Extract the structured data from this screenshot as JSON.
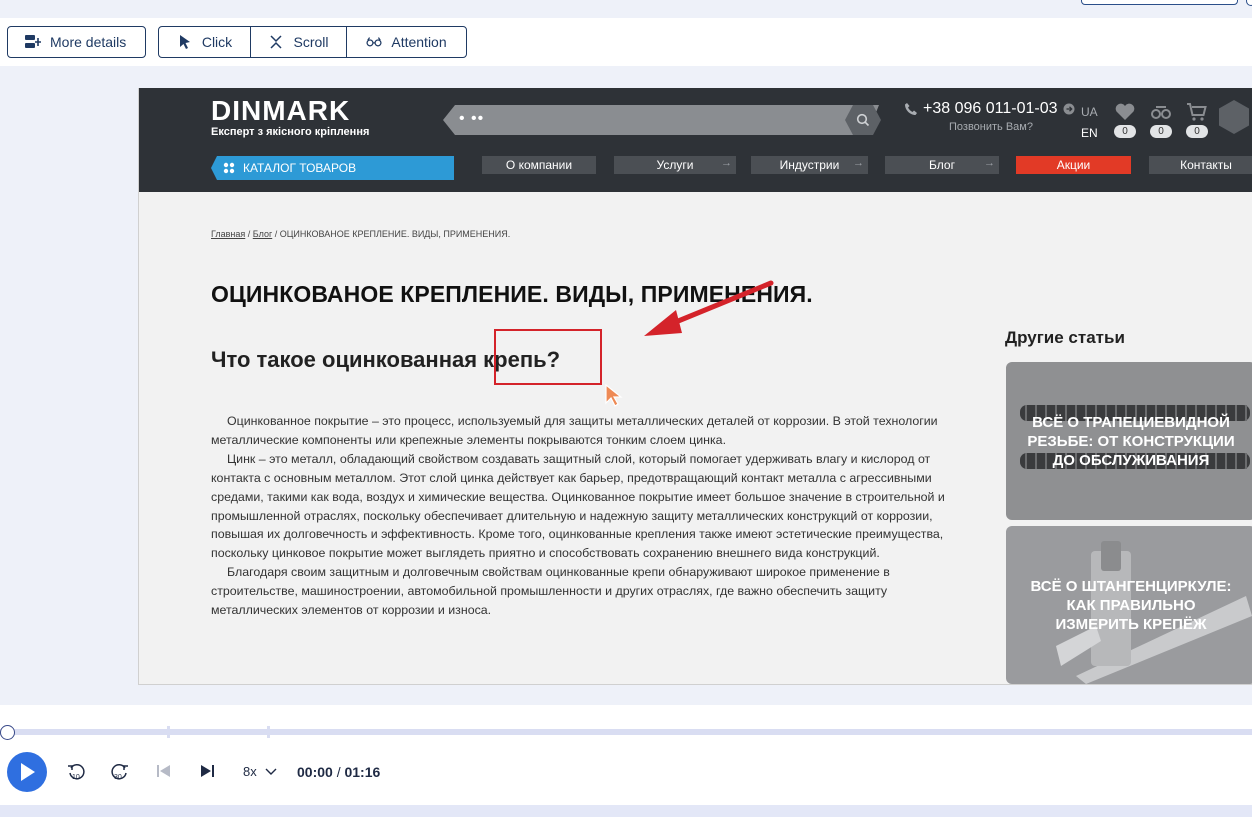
{
  "toolbar": {
    "more_details": "More details",
    "click": "Click",
    "scroll": "Scroll",
    "attention": "Attention"
  },
  "site": {
    "logo_word": "DINMARK",
    "logo_tagline": "Експерт з якісного кріплення",
    "search_value": "• ••",
    "phone": "+38 096 011-01-03",
    "callback": "Позвонить Вам?",
    "lang_ua": "UA",
    "lang_en": "EN",
    "wishlist_count": "0",
    "compare_count": "0",
    "cart_count": "0",
    "catalog": "КАТАЛОГ ТОВАРОВ",
    "nav": [
      "О компании",
      "Услуги",
      "Индустрии",
      "Блог",
      "Акции",
      "Контакты"
    ],
    "sale_color": "#e23a26",
    "accent_color": "#2d9ad6"
  },
  "breadcrumb": {
    "home": "Главная",
    "blog": "Блог",
    "current": "ОЦИНКОВАНОЕ КРЕПЛЕНИЕ. ВИДЫ, ПРИМЕНЕНИЯ."
  },
  "article": {
    "title": "ОЦИНКОВАНОЕ КРЕПЛЕНИЕ. ВИДЫ, ПРИМЕНЕНИЯ.",
    "subtitle": "Что такое оцинкованная крепь?",
    "paragraphs": [
      "Оцинкованное покрытие – это процесс, используемый для защиты металлических деталей от коррозии. В этой технологии металлические компоненты или крепежные элементы покрываются тонким слоем цинка.",
      "Цинк – это металл, обладающий свойством создавать защитный слой, который помогает удерживать влагу и кислород от контакта с основным металлом. Этот слой цинка действует как барьер, предотвращающий контакт металла с агрессивными средами, такими как вода, воздух и химические вещества. Оцинкованное покрытие имеет большое значение в строительной и промышленной отраслях, поскольку обеспечивает длительную и надежную защиту металлических конструкций от коррозии, повышая их долговечность и эффективность. Кроме того, оцинкованные крепления также имеют эстетические преимущества, поскольку цинковое покрытие может выглядеть приятно и способствовать сохранению внешнего вида конструкций.",
      "Благодаря своим защитным и долговечным свойствам оцинкованные крепи обнаруживают широкое применение в строительстве, машиностроении, автомобильной промышленности и других отраслях, где важно обеспечить защиту металлических элементов от коррозии и износа."
    ]
  },
  "sidebar": {
    "title": "Другие статьи",
    "cards": [
      "ВСЁ О ТРАПЕЦИЕВИДНОЙ РЕЗЬБЕ: ОТ КОНСТРУКЦИИ ДО ОБСЛУЖИВАНИЯ",
      "ВСЁ О ШТАНГЕНЦИРКУЛЕ: КАК ПРАВИЛЬНО ИЗМЕРИТЬ КРЕПЁЖ"
    ]
  },
  "player": {
    "rewind": "10",
    "forward": "30",
    "speed": "8x",
    "current_time": "00:00",
    "separator": " / ",
    "total_time": "01:16",
    "progress": 0
  },
  "annotation": {
    "highlight_color": "#d4232a"
  }
}
